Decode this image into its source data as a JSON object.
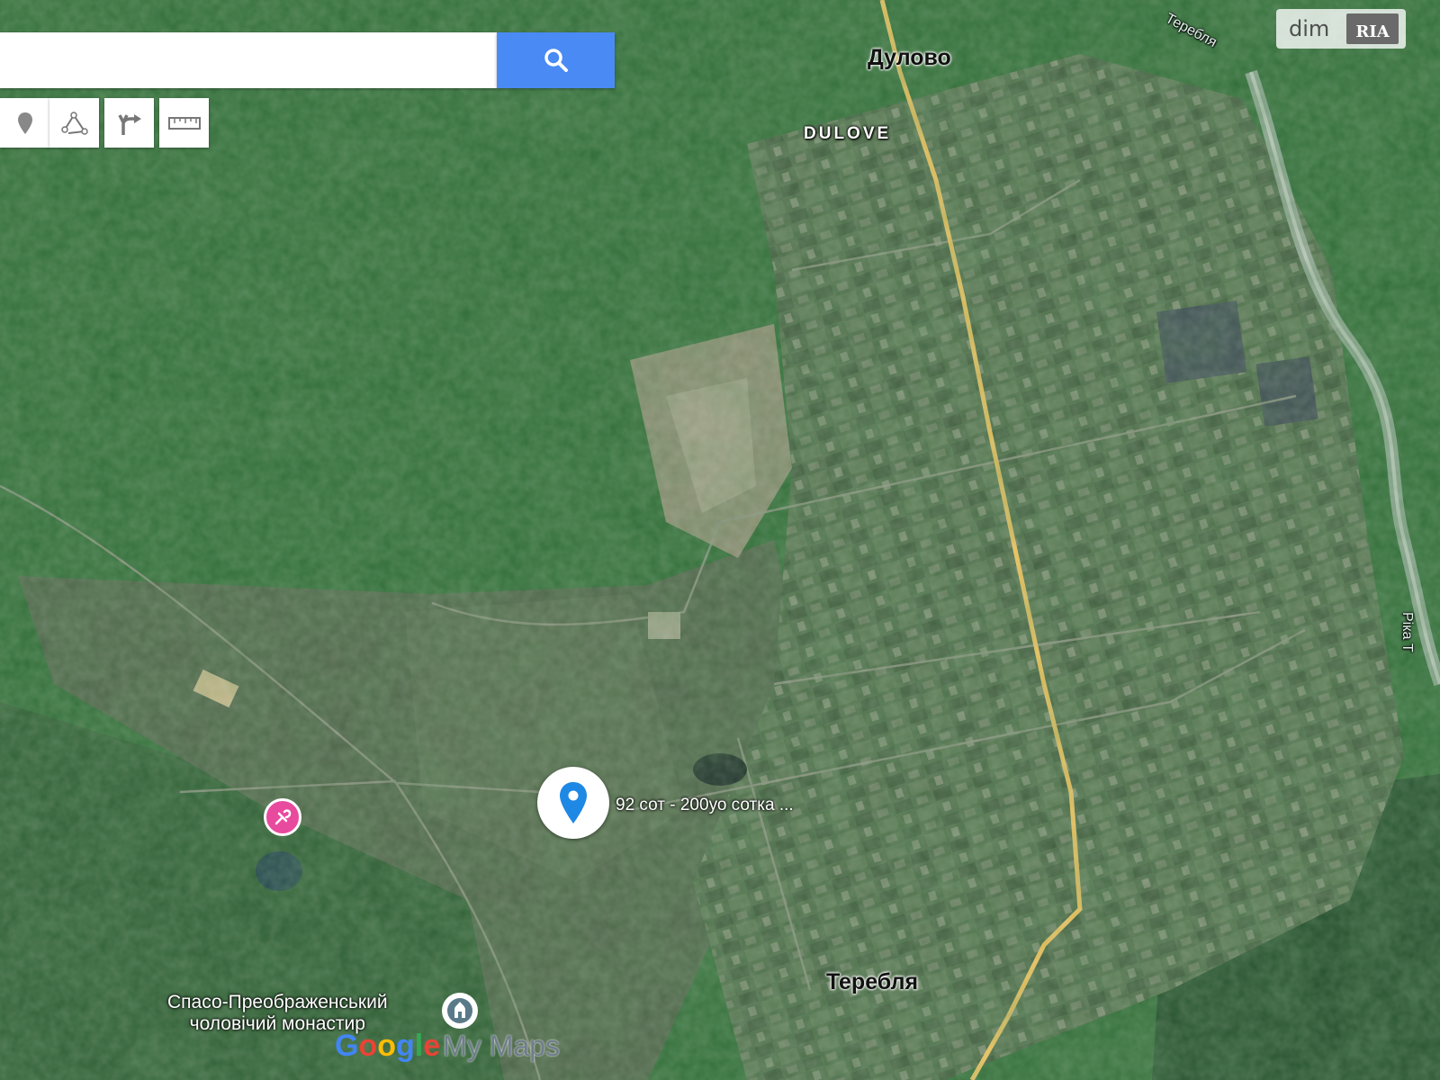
{
  "search": {
    "value": "",
    "placeholder": ""
  },
  "search_button": {
    "icon": "search-icon"
  },
  "toolbar": [
    {
      "icon": "marker-icon"
    },
    {
      "icon": "line-icon"
    },
    {
      "icon": "route-icon"
    },
    {
      "icon": "ruler-icon"
    }
  ],
  "watermark": {
    "text": "dim",
    "logo_text": "RIA"
  },
  "places": {
    "dulovo": "Дулово",
    "dulove": "DULOVE",
    "terebla": "Теребля",
    "river_top": "Теребля",
    "river_right": "Ріка Т"
  },
  "marker": {
    "icon": "location-pin-icon",
    "label": "92 сот - 200уо сотка ..."
  },
  "pois": {
    "monastery_line1": "Спасо-Преображенський",
    "monastery_line2": "чоловічий монастир"
  },
  "branding": {
    "google": "Google",
    "mymaps": "My Maps"
  },
  "colors": {
    "search_button": "#4a8af4",
    "marker": "#1e88e5",
    "road": "#f2c35a",
    "poi": "#e84a9e"
  }
}
